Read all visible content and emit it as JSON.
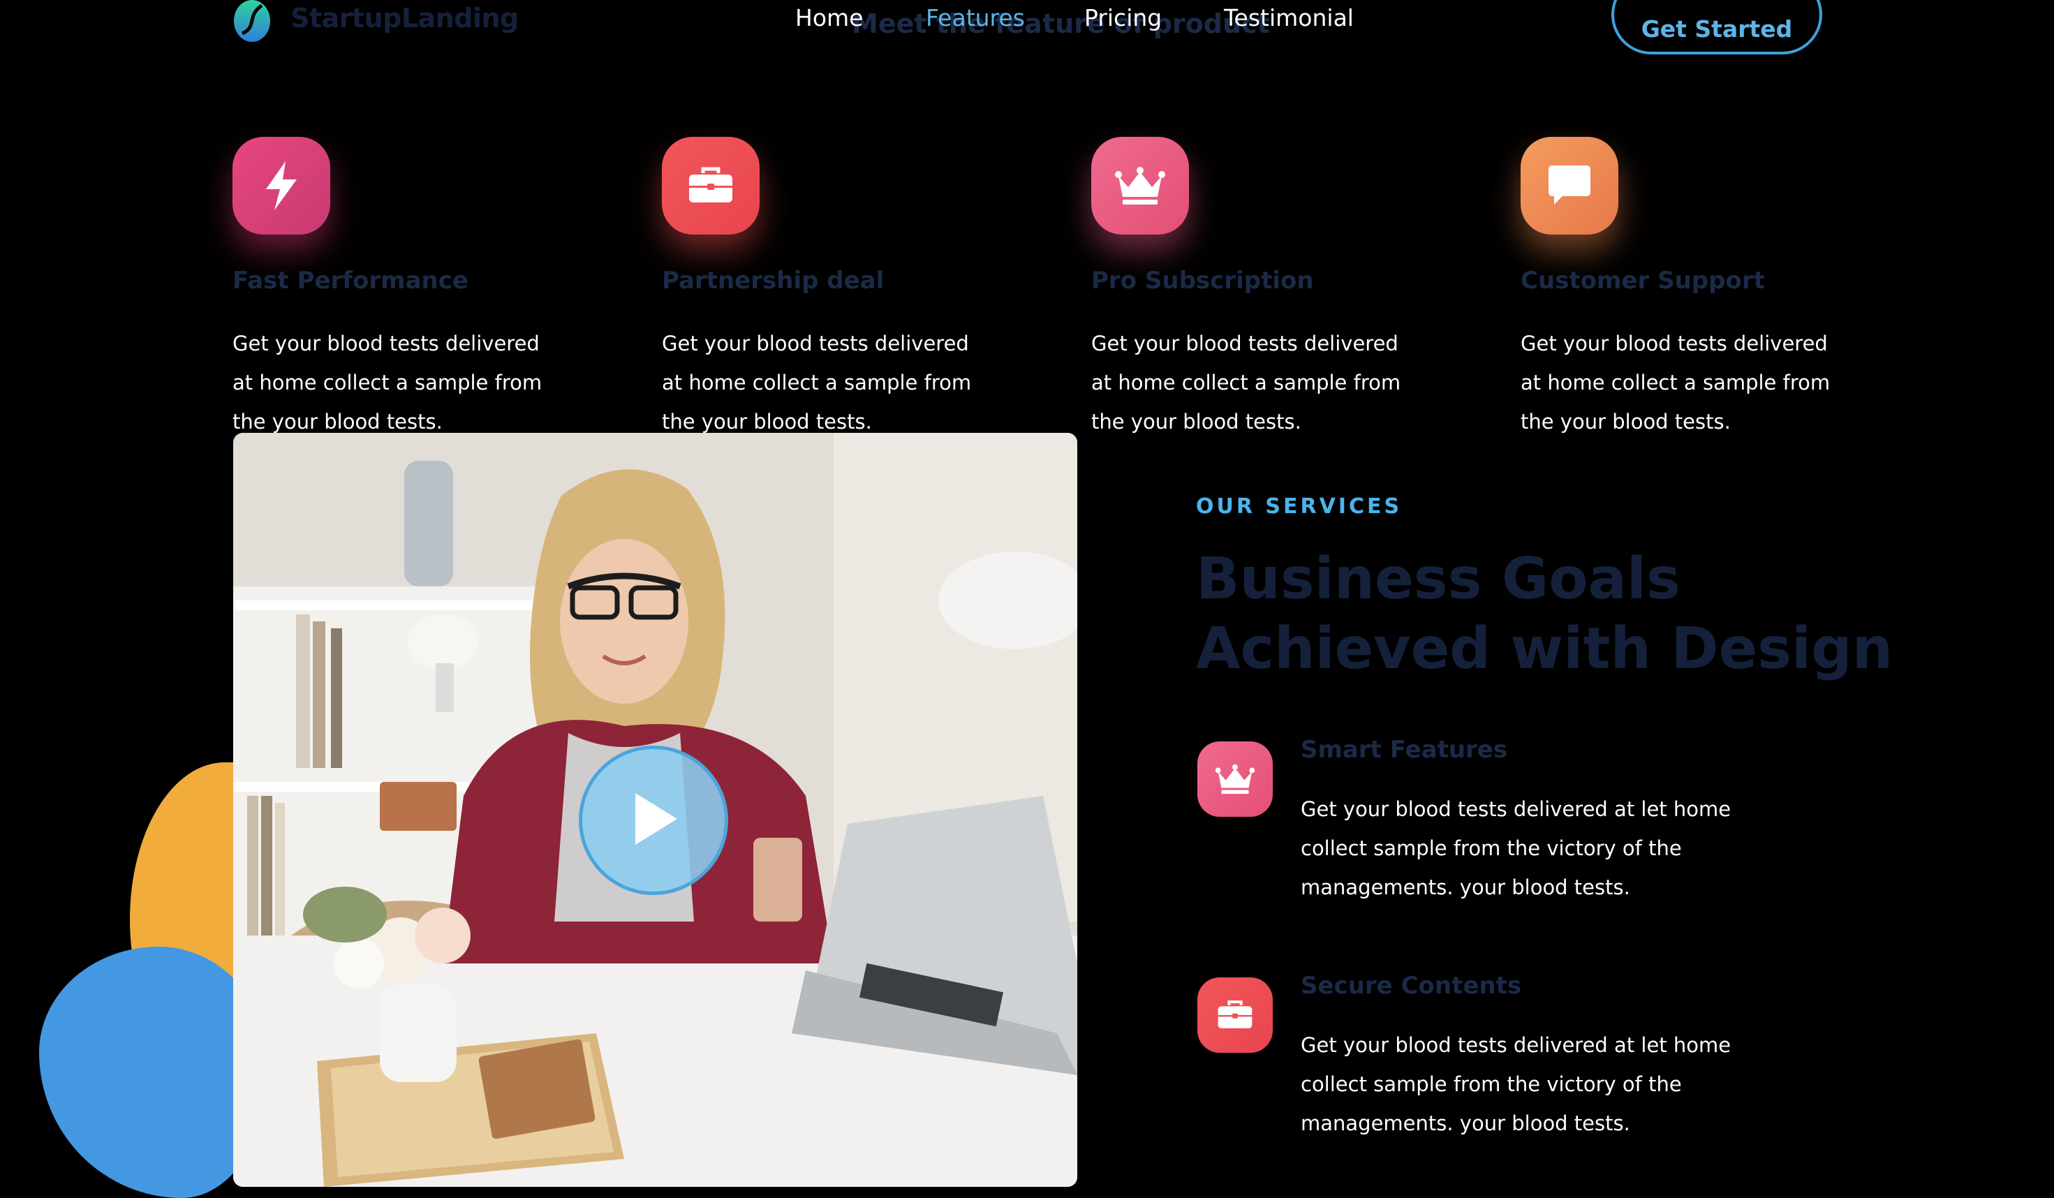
{
  "header": {
    "brand": "StartupLanding",
    "ghost_heading": "Meet the feature of product",
    "nav": [
      "Home",
      "Features",
      "Pricing",
      "Testimonial"
    ],
    "active_nav": "Features",
    "cta_label": "Get Started"
  },
  "features": [
    {
      "icon": "lightning-icon",
      "title": "Fast Performance",
      "text": "Get your blood tests delivered at home collect a sample from the your blood tests."
    },
    {
      "icon": "briefcase-icon",
      "title": "Partnership deal",
      "text": "Get your blood tests delivered at home collect a sample from the your blood tests."
    },
    {
      "icon": "crown-icon",
      "title": "Pro Subscription",
      "text": "Get your blood tests delivered at home collect a sample from the your blood tests."
    },
    {
      "icon": "chat-bubble-icon",
      "title": "Customer Support",
      "text": "Get your blood tests delivered at home collect a sample from the your blood tests."
    }
  ],
  "services": {
    "label": "OUR SERVICES",
    "heading": "Business Goals Achieved with Design",
    "items": [
      {
        "icon": "crown-icon",
        "title": "Smart Features",
        "text": "Get your blood tests delivered at let home collect sample from the victory of the managements. your blood tests."
      },
      {
        "icon": "briefcase-icon",
        "title": "Secure Contents",
        "text": "Get your blood tests delivered at let home collect sample from the victory of the managements. your blood tests."
      }
    ]
  },
  "video": {
    "play_icon": "play-icon"
  },
  "colors": {
    "accent_blue": "#5fb4e6",
    "heading_navy": "#15213b",
    "icon_pink": "#e8467f",
    "icon_red": "#f2565a",
    "icon_orange": "#f39c5e"
  }
}
